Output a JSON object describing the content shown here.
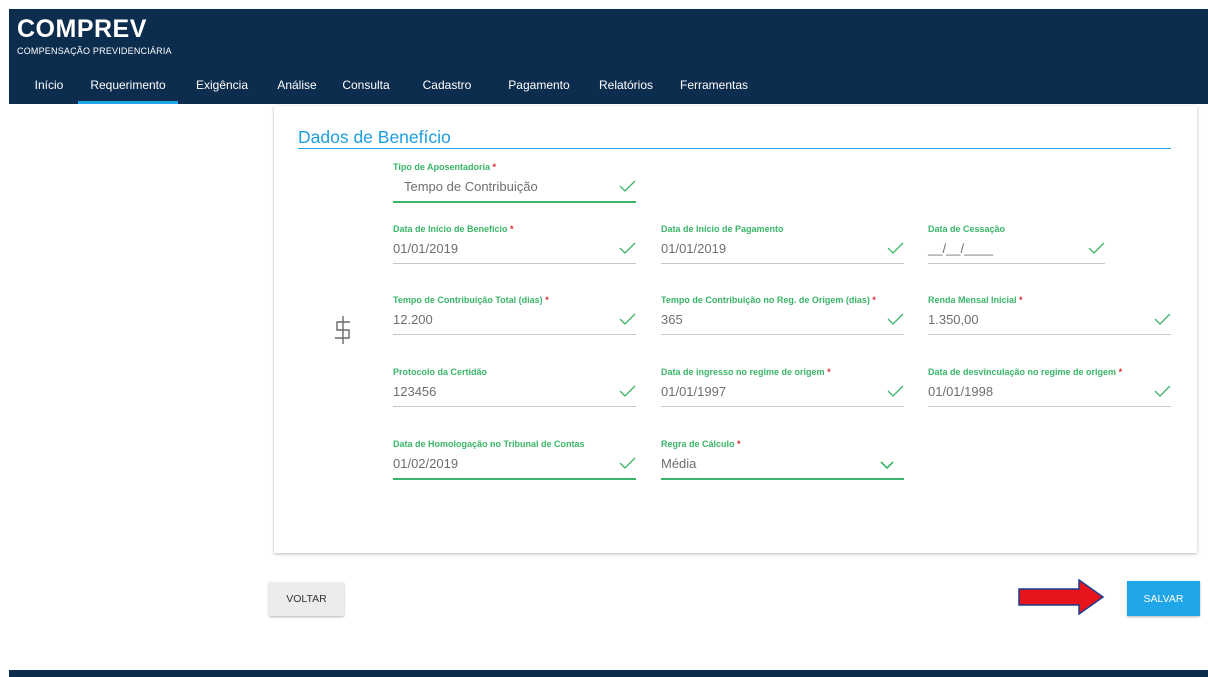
{
  "header": {
    "title": "COMPREV",
    "subtitle": "COMPENSAÇÃO PREVIDENCIÁRIA",
    "background_color": "#0d2d4e",
    "active_tab_color": "#1fa6e8"
  },
  "nav": {
    "items": [
      {
        "label": "Início"
      },
      {
        "label": "Requerimento",
        "active": true
      },
      {
        "label": "Exigência"
      },
      {
        "label": "Análise"
      },
      {
        "label": "Consulta"
      },
      {
        "label": "Cadastro"
      },
      {
        "label": "Pagamento"
      },
      {
        "label": "Relatórios"
      },
      {
        "label": "Ferramentas"
      }
    ]
  },
  "section": {
    "title": "Dados de Benefício",
    "icon": "dollar-icon"
  },
  "fields": [
    {
      "id": "tipo-aposentadoria",
      "label": "Tipo de Aposentadoria",
      "required": "*",
      "value": "Tempo de Contribuição",
      "control": "select",
      "icon": "check-icon"
    },
    {
      "id": "data-inicio-beneficio",
      "label": "Data de Início de Benefício",
      "required": "*",
      "value": "01/01/2019",
      "control": "text",
      "icon": "check-icon"
    },
    {
      "id": "data-inicio-pagamento",
      "label": "Data de Início de Pagamento",
      "required": "",
      "value": "01/01/2019",
      "control": "text",
      "icon": "check-icon"
    },
    {
      "id": "data-cessacao",
      "label": "Data de Cessação",
      "required": "",
      "value": "__/__/____",
      "control": "text",
      "icon": "check-icon"
    },
    {
      "id": "tempo-contribuicao-total",
      "label": "Tempo de Contribuição Total (dias)",
      "required": "*",
      "value": "12.200",
      "control": "text",
      "icon": "check-icon"
    },
    {
      "id": "tempo-contribuicao-origem",
      "label": "Tempo de Contribuição no Reg. de Origem (dias)",
      "required": "*",
      "value": "365",
      "control": "text",
      "icon": "check-icon"
    },
    {
      "id": "renda-mensal-inicial",
      "label": "Renda Mensal Inicial",
      "required": "*",
      "value": "1.350,00",
      "control": "text",
      "icon": "check-icon"
    },
    {
      "id": "protocolo-certidao",
      "label": "Protocolo da Certidão",
      "required": "",
      "value": "123456",
      "control": "text",
      "icon": "check-icon"
    },
    {
      "id": "data-ingresso-regime",
      "label": "Data de ingresso no regime de origem",
      "required": "*",
      "value": "01/01/1997",
      "control": "text",
      "icon": "check-icon"
    },
    {
      "id": "data-desvinculacao-regime",
      "label": "Data de desvinculação no regime de origem",
      "required": "*",
      "value": "01/01/1998",
      "control": "text",
      "icon": "check-icon"
    },
    {
      "id": "data-homologacao",
      "label": "Data de Homologação no Tribunal de Contas",
      "required": "",
      "value": "01/02/2019",
      "control": "text",
      "icon": "check-icon"
    },
    {
      "id": "regra-calculo",
      "label": "Regra de Cálculo",
      "required": "*",
      "value": "Média",
      "control": "select",
      "icon": "chevron-down-icon"
    }
  ],
  "buttons": {
    "back_label": "VOLTAR",
    "save_label": "SALVAR"
  },
  "annotation": {
    "icon": "red-arrow-icon",
    "color": "#e8141b"
  },
  "colors": {
    "accent_blue": "#1a9fe0",
    "valid_green": "#3ab569",
    "required_red": "#e0262b"
  }
}
